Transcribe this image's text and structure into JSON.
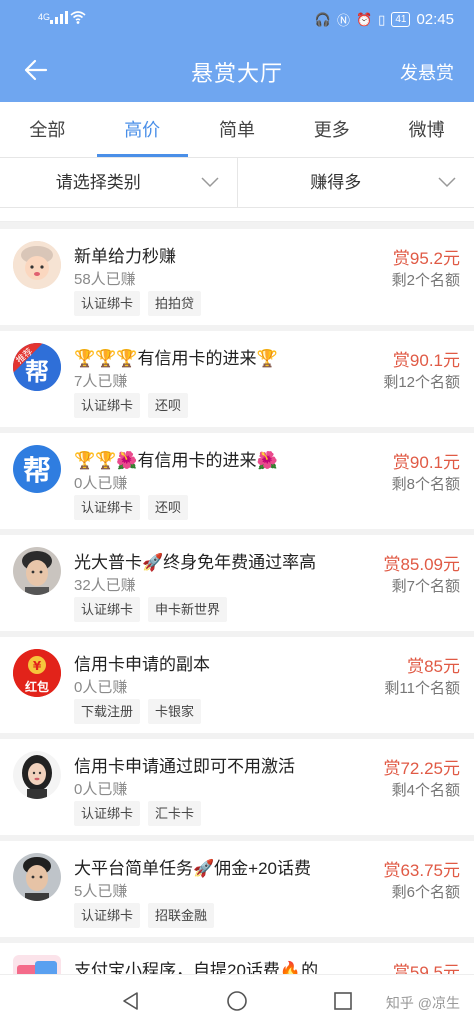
{
  "status_bar": {
    "network": "4G",
    "time": "02:45",
    "battery": "41",
    "icons": [
      "signal-icon",
      "wifi-icon",
      "headphone-icon",
      "nfc-icon",
      "alarm-icon",
      "vibrate-icon",
      "battery-icon"
    ]
  },
  "header": {
    "title": "悬赏大厅",
    "action_label": "发悬赏",
    "back_icon": "back-arrow-icon"
  },
  "tabs": [
    {
      "label": "全部",
      "active": false
    },
    {
      "label": "高价",
      "active": true
    },
    {
      "label": "简单",
      "active": false
    },
    {
      "label": "更多",
      "active": false
    },
    {
      "label": "微博",
      "active": false
    }
  ],
  "filters": {
    "category": "请选择类别",
    "sort": "赚得多"
  },
  "items": [
    {
      "title": "新单给力秒赚",
      "earned": "58人已赚",
      "tags": [
        "认证绑卡",
        "拍拍贷"
      ],
      "reward": "赏95.2元",
      "quota": "剩2个名额",
      "avatar": "baby-avatar"
    },
    {
      "title": "🏆🏆🏆有信用卡的进来🏆",
      "earned": "7人已赚",
      "tags": [
        "认证绑卡",
        "还呗"
      ],
      "reward": "赏90.1元",
      "quota": "剩12个名额",
      "avatar": "recommend-bang-avatar",
      "avatar_text": "推荐"
    },
    {
      "title": "🏆🏆🌺有信用卡的进来🌺",
      "earned": "0人已赚",
      "tags": [
        "认证绑卡",
        "还呗"
      ],
      "reward": "赏90.1元",
      "quota": "剩8个名额",
      "avatar": "bang-avatar",
      "avatar_text": "帮"
    },
    {
      "title": "光大普卡🚀终身免年费通过率高",
      "earned": "32人已赚",
      "tags": [
        "认证绑卡",
        "申卡新世界"
      ],
      "reward": "赏85.09元",
      "quota": "剩7个名额",
      "avatar": "man-avatar"
    },
    {
      "title": "信用卡申请的副本",
      "earned": "0人已赚",
      "tags": [
        "下载注册",
        "卡银家"
      ],
      "reward": "赏85元",
      "quota": "剩11个名额",
      "avatar": "red-packet-avatar",
      "avatar_text": "红包"
    },
    {
      "title": "信用卡申请通过即可不用激活",
      "earned": "0人已赚",
      "tags": [
        "认证绑卡",
        "汇卡卡"
      ],
      "reward": "赏72.25元",
      "quota": "剩4个名额",
      "avatar": "woman-avatar"
    },
    {
      "title": "大平台简单任务🚀佣金+20话费",
      "earned": "5人已赚",
      "tags": [
        "认证绑卡",
        "招联金融"
      ],
      "reward": "赏63.75元",
      "quota": "剩6个名额",
      "avatar": "man-avatar-2"
    },
    {
      "title": "支付宝小程序，自提20话费🔥的",
      "earned": "",
      "tags": [],
      "reward": "赏59.5元",
      "quota": "",
      "avatar": "promo-avatar"
    }
  ],
  "nav": {
    "icons": [
      "nav-back-icon",
      "nav-home-icon",
      "nav-recent-icon"
    ]
  },
  "watermark": "知乎 @凉生",
  "colors": {
    "header_bg": "#6fa6f0",
    "accent": "#4a8fe8",
    "reward": "#e05a45"
  }
}
